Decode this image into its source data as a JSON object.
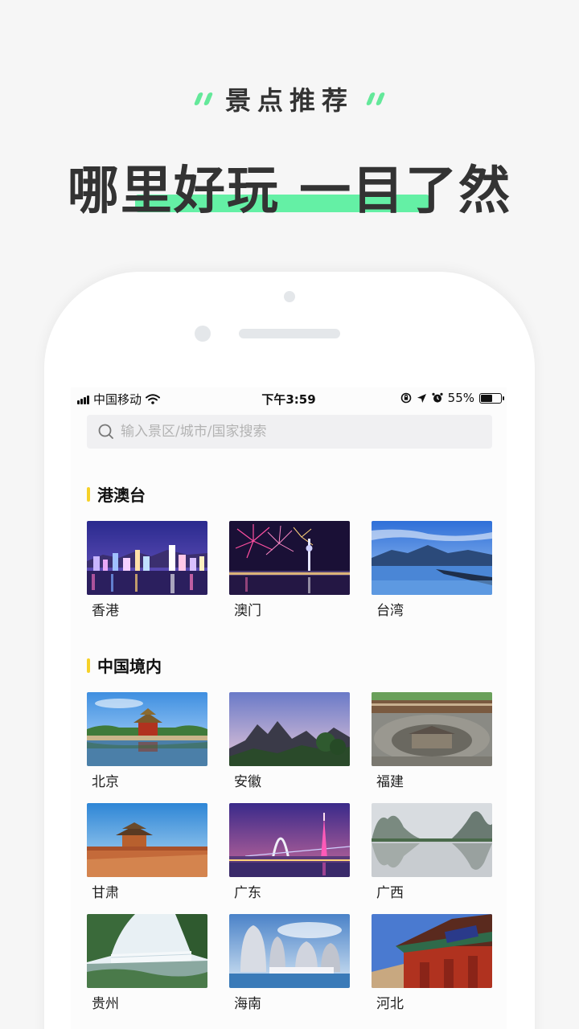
{
  "promo": {
    "subtitle": "景点推荐",
    "title": "哪里好玩 一目了然"
  },
  "statusbar": {
    "carrier": "中国移动",
    "time": "下午3:59",
    "battery": "55%",
    "battery_level": 0.55
  },
  "search": {
    "placeholder": "输入景区/城市/国家搜索"
  },
  "sections": [
    {
      "title": "港澳台",
      "items": [
        {
          "label": "香港",
          "image": "hong-kong-skyline"
        },
        {
          "label": "澳门",
          "image": "macau-fireworks"
        },
        {
          "label": "台湾",
          "image": "taiwan-lake"
        }
      ]
    },
    {
      "title": "中国境内",
      "items": [
        {
          "label": "北京",
          "image": "forbidden-city-tower"
        },
        {
          "label": "安徽",
          "image": "huangshan-mountains"
        },
        {
          "label": "福建",
          "image": "tulou-roundhouse"
        },
        {
          "label": "甘肃",
          "image": "jiayuguan-fort"
        },
        {
          "label": "广东",
          "image": "canton-tower"
        },
        {
          "label": "广西",
          "image": "guilin-karst-river"
        },
        {
          "label": "贵州",
          "image": "waterfall"
        },
        {
          "label": "海南",
          "image": "hainan-towers"
        },
        {
          "label": "河北",
          "image": "temple-gate"
        }
      ]
    }
  ],
  "colors": {
    "accent_green": "#64f0a5",
    "section_bar": "#f6d128"
  }
}
